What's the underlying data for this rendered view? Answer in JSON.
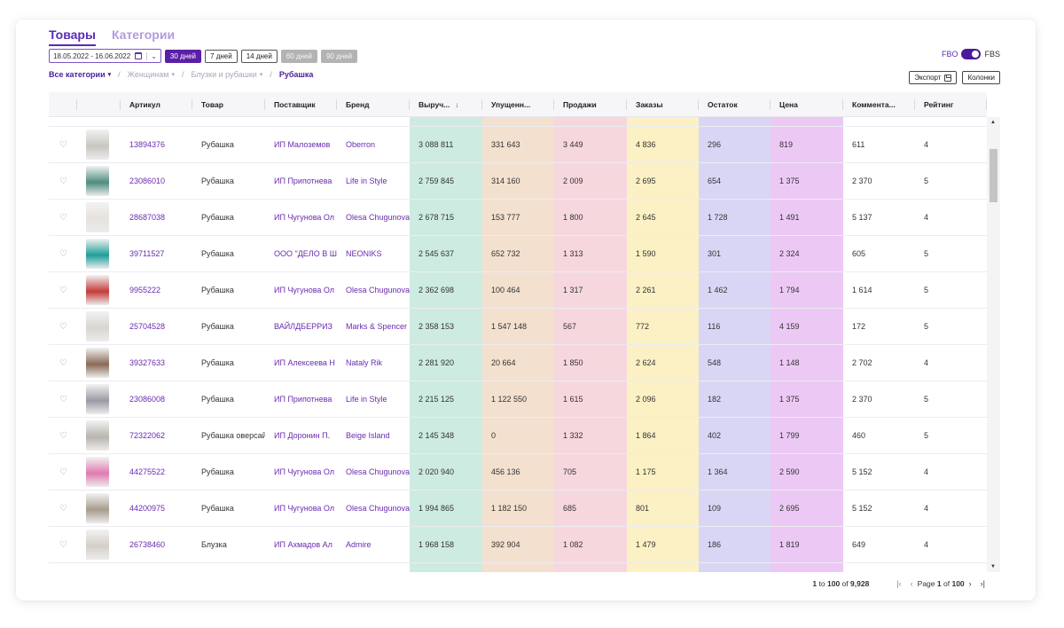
{
  "tabs": [
    {
      "label": "Товары",
      "active": true
    },
    {
      "label": "Категории",
      "active": false
    }
  ],
  "date_range": "18.05.2022 - 16.06.2022",
  "periods": [
    {
      "label": "30 дней",
      "state": "active"
    },
    {
      "label": "7 дней",
      "state": "normal"
    },
    {
      "label": "14 дней",
      "state": "normal"
    },
    {
      "label": "60 дней",
      "state": "disabled"
    },
    {
      "label": "90 дней",
      "state": "disabled"
    }
  ],
  "toggle": {
    "left": "FBO",
    "right": "FBS"
  },
  "breadcrumb": [
    {
      "label": "Все категории"
    },
    {
      "label": "Женщинам"
    },
    {
      "label": "Блузки и рубашки"
    },
    {
      "label": "Рубашка"
    }
  ],
  "buttons": {
    "export": "Экспорт",
    "columns": "Колонки"
  },
  "colors": {
    "accent": "#5b2bb5",
    "revenue_col": "#cdebe1",
    "lost_col": "#f3e0cf",
    "sales_col": "#f7d7de",
    "orders_col": "#fbf1c4",
    "stock_col": "#d9d6f5",
    "price_col": "#ecc9f5"
  },
  "columns": [
    "Артикул",
    "Товар",
    "Поставщик",
    "Бренд",
    "Выруч...",
    "Упущенн...",
    "Продажи",
    "Заказы",
    "Остаток",
    "Цена",
    "Коммента...",
    "Рейтинг"
  ],
  "rows": [
    {
      "article": "13894376",
      "product": "Рубашка",
      "supplier": "ИП Малоземов",
      "brand": "Oberron",
      "revenue": "3 088 811",
      "lost": "331 643",
      "sales": "3 449",
      "orders": "4 836",
      "stock": "296",
      "price": "819",
      "comments": "611",
      "rating": "4",
      "img": "#c9c6c0"
    },
    {
      "article": "23086010",
      "product": "Рубашка",
      "supplier": "ИП Припотнева",
      "brand": "Life in Style",
      "revenue": "2 759 845",
      "lost": "314 160",
      "sales": "2 009",
      "orders": "2 695",
      "stock": "654",
      "price": "1 375",
      "comments": "2 370",
      "rating": "5",
      "img": "#4e8d80"
    },
    {
      "article": "28687038",
      "product": "Рубашка",
      "supplier": "ИП Чугунова Ол",
      "brand": "Olesa Chugunova",
      "revenue": "2 678 715",
      "lost": "153 777",
      "sales": "1 800",
      "orders": "2 645",
      "stock": "1 728",
      "price": "1 491",
      "comments": "5 137",
      "rating": "4",
      "img": "#e6e2dc"
    },
    {
      "article": "39711527",
      "product": "Рубашка",
      "supplier": "ООО \"ДЕЛО В Ш",
      "brand": "NEONIKS",
      "revenue": "2 545 637",
      "lost": "652 732",
      "sales": "1 313",
      "orders": "1 590",
      "stock": "301",
      "price": "2 324",
      "comments": "605",
      "rating": "5",
      "img": "#1f9e9a"
    },
    {
      "article": "9955222",
      "product": "Рубашка",
      "supplier": "ИП Чугунова Ол",
      "brand": "Olesa Chugunova",
      "revenue": "2 362 698",
      "lost": "100 464",
      "sales": "1 317",
      "orders": "2 261",
      "stock": "1 462",
      "price": "1 794",
      "comments": "1 614",
      "rating": "5",
      "img": "#c53a3a"
    },
    {
      "article": "25704528",
      "product": "Рубашка",
      "supplier": "ВАЙЛДБЕРРИЗ",
      "brand": "Marks & Spencer",
      "revenue": "2 358 153",
      "lost": "1 547 148",
      "sales": "567",
      "orders": "772",
      "stock": "116",
      "price": "4 159",
      "comments": "172",
      "rating": "5",
      "img": "#d9d6d0"
    },
    {
      "article": "39327633",
      "product": "Рубашка",
      "supplier": "ИП Алексеева Н",
      "brand": "Nataly Rik",
      "revenue": "2 281 920",
      "lost": "20 664",
      "sales": "1 850",
      "orders": "2 624",
      "stock": "548",
      "price": "1 148",
      "comments": "2 702",
      "rating": "4",
      "img": "#8a6a55"
    },
    {
      "article": "23086008",
      "product": "Рубашка",
      "supplier": "ИП Припотнева",
      "brand": "Life in Style",
      "revenue": "2 215 125",
      "lost": "1 122 550",
      "sales": "1 615",
      "orders": "2 096",
      "stock": "182",
      "price": "1 375",
      "comments": "2 370",
      "rating": "5",
      "img": "#9a9aa4"
    },
    {
      "article": "72322062",
      "product": "Рубашка оверсайз",
      "supplier": "ИП Доронин П.",
      "brand": "Beige Island",
      "revenue": "2 145 348",
      "lost": "0",
      "sales": "1 332",
      "orders": "1 864",
      "stock": "402",
      "price": "1 799",
      "comments": "460",
      "rating": "5",
      "img": "#b8b4ae"
    },
    {
      "article": "44275522",
      "product": "Рубашка",
      "supplier": "ИП Чугунова Ол",
      "brand": "Olesa Chugunova",
      "revenue": "2 020 940",
      "lost": "456 136",
      "sales": "705",
      "orders": "1 175",
      "stock": "1 364",
      "price": "2 590",
      "comments": "5 152",
      "rating": "4",
      "img": "#e07ab0"
    },
    {
      "article": "44200975",
      "product": "Рубашка",
      "supplier": "ИП Чугунова Ол",
      "brand": "Olesa Chugunova",
      "revenue": "1 994 865",
      "lost": "1 182 150",
      "sales": "685",
      "orders": "801",
      "stock": "109",
      "price": "2 695",
      "comments": "5 152",
      "rating": "4",
      "img": "#a89c8c"
    },
    {
      "article": "26738460",
      "product": "Блузка",
      "supplier": "ИП Ахмадов Ал",
      "brand": "Admire",
      "revenue": "1 968 158",
      "lost": "392 904",
      "sales": "1 082",
      "orders": "1 479",
      "stock": "186",
      "price": "1 819",
      "comments": "649",
      "rating": "4",
      "img": "#d4cfc8"
    }
  ],
  "pagination": {
    "range_from": "1",
    "to_word": "to",
    "range_to": "100",
    "of_word": "of",
    "total": "9,928",
    "page_word": "Page",
    "page": "1",
    "page_of_word": "of",
    "page_total": "100"
  }
}
